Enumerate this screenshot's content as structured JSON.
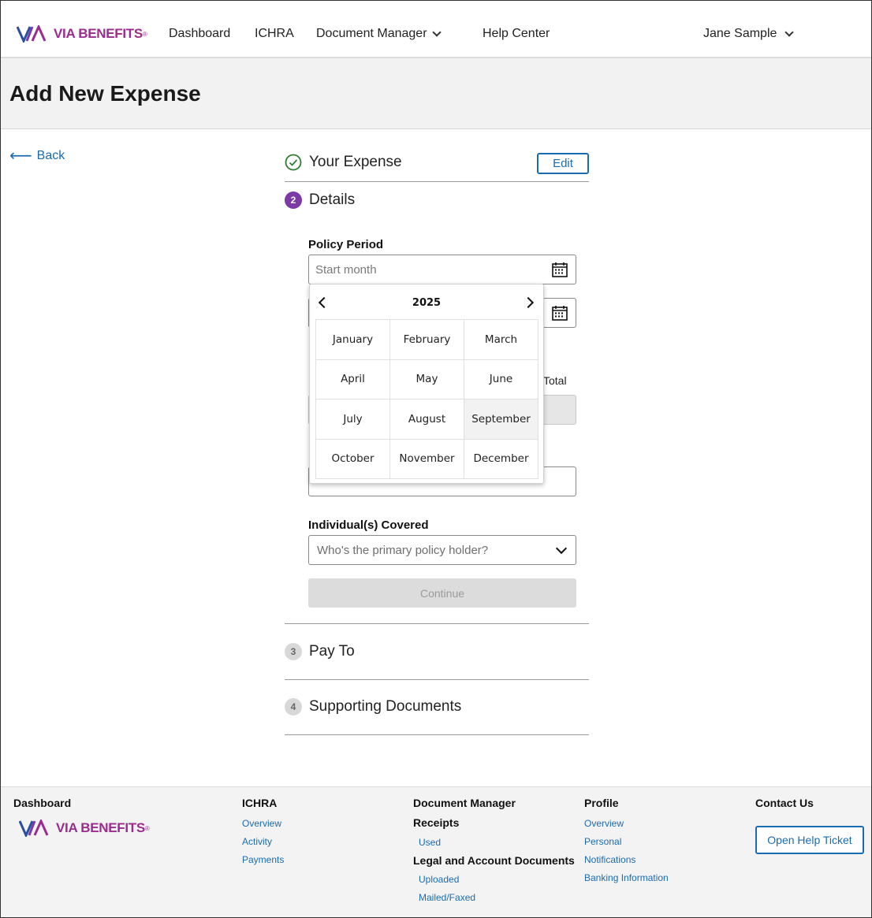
{
  "header": {
    "logo_mark": "V/A",
    "logo_text": "VIA BENEFITS",
    "logo_reg": "®",
    "nav": {
      "dashboard": "Dashboard",
      "ichra": "ICHRA",
      "document_manager": "Document Manager",
      "help_center": "Help Center",
      "user": "Jane Sample"
    }
  },
  "page": {
    "title": "Add New Expense",
    "back_label": "Back"
  },
  "steps": [
    {
      "number": "",
      "title": "Your Expense",
      "status": "complete",
      "action": "Edit"
    },
    {
      "number": "2",
      "title": "Details",
      "status": "active"
    },
    {
      "number": "3",
      "title": "Pay To",
      "status": "pending"
    },
    {
      "number": "4",
      "title": "Supporting Documents",
      "status": "pending"
    }
  ],
  "form": {
    "policy_period_label": "Policy Period",
    "start_placeholder": "Start month",
    "total_label": "Total",
    "individuals_label": "Individual(s) Covered",
    "individuals_placeholder": "Who's the primary policy holder?",
    "continue_label": "Continue"
  },
  "picker": {
    "year": "2025",
    "months": [
      "January",
      "February",
      "March",
      "April",
      "May",
      "June",
      "July",
      "August",
      "September",
      "October",
      "November",
      "December"
    ],
    "hovered": "September"
  },
  "footer": {
    "dashboard": {
      "heading": "Dashboard"
    },
    "ichra": {
      "heading": "ICHRA",
      "links": [
        "Overview",
        "Activity",
        "Payments"
      ]
    },
    "document_manager": {
      "heading": "Document Manager",
      "receipts_heading": "Receipts",
      "receipts_links": [
        "Used"
      ],
      "legal_heading": "Legal and Account Documents",
      "legal_links": [
        "Uploaded",
        "Mailed/Faxed"
      ]
    },
    "profile": {
      "heading": "Profile",
      "links": [
        "Overview",
        "Personal",
        "Notifications",
        "Banking Information"
      ]
    },
    "contact": {
      "heading": "Contact Us",
      "button": "Open Help Ticket"
    }
  },
  "colors": {
    "link_blue": "#1a6bb0",
    "brand_purple": "#9b2c8f",
    "brand_blue": "#2a4fa0",
    "active_step": "#7b3aa6",
    "check_green": "#2e7d32"
  }
}
